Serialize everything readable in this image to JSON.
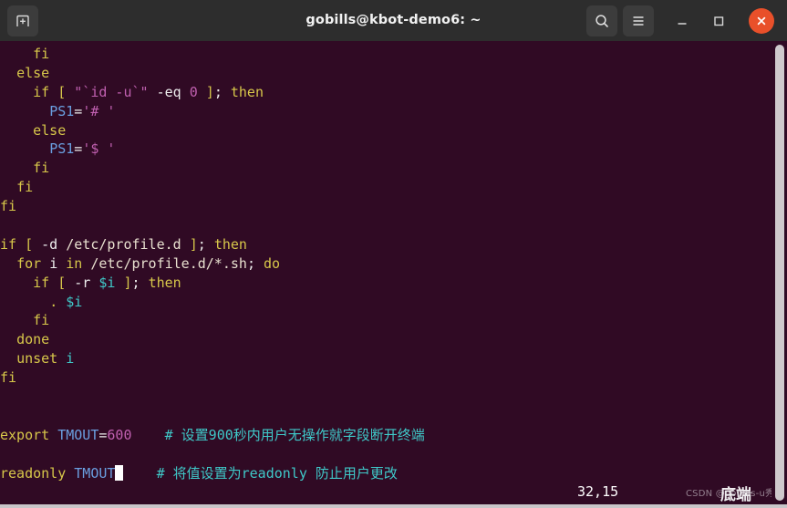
{
  "window": {
    "title": "gobills@kbot-demo6: ~",
    "titlebar_bg": "#2d2d2d",
    "terminal_bg": "#300a24",
    "close_button_color": "#e9502a"
  },
  "titlebar": {
    "new_tab_icon": "new-tab-icon",
    "search_icon": "search-icon",
    "menu_icon": "hamburger-menu-icon",
    "minimize_icon": "minimize-icon",
    "maximize_icon": "maximize-icon",
    "close_icon": "close-icon"
  },
  "terminal": {
    "lines": [
      {
        "indent": "    ",
        "segments": [
          {
            "t": "fi",
            "c": "kw"
          }
        ]
      },
      {
        "indent": "  ",
        "segments": [
          {
            "t": "else",
            "c": "kw"
          }
        ]
      },
      {
        "indent": "    ",
        "segments": [
          {
            "t": "if",
            "c": "kw"
          },
          {
            "t": " ",
            "c": "wh"
          },
          {
            "t": "[",
            "c": "kw"
          },
          {
            "t": " ",
            "c": "wh"
          },
          {
            "t": "\"`id -u`\"",
            "c": "str"
          },
          {
            "t": " ",
            "c": "wh"
          },
          {
            "t": "-eq",
            "c": "wh"
          },
          {
            "t": " ",
            "c": "wh"
          },
          {
            "t": "0",
            "c": "num"
          },
          {
            "t": " ",
            "c": "wh"
          },
          {
            "t": "]",
            "c": "kw"
          },
          {
            "t": ";",
            "c": "wh"
          },
          {
            "t": " ",
            "c": "wh"
          },
          {
            "t": "then",
            "c": "kw"
          }
        ]
      },
      {
        "indent": "      ",
        "segments": [
          {
            "t": "PS1",
            "c": "var"
          },
          {
            "t": "=",
            "c": "wh"
          },
          {
            "t": "'# '",
            "c": "str"
          }
        ]
      },
      {
        "indent": "    ",
        "segments": [
          {
            "t": "else",
            "c": "kw"
          }
        ]
      },
      {
        "indent": "      ",
        "segments": [
          {
            "t": "PS1",
            "c": "var"
          },
          {
            "t": "=",
            "c": "wh"
          },
          {
            "t": "'$ '",
            "c": "str"
          }
        ]
      },
      {
        "indent": "    ",
        "segments": [
          {
            "t": "fi",
            "c": "kw"
          }
        ]
      },
      {
        "indent": "  ",
        "segments": [
          {
            "t": "fi",
            "c": "kw"
          }
        ]
      },
      {
        "indent": "",
        "segments": [
          {
            "t": "fi",
            "c": "kw"
          }
        ]
      },
      {
        "indent": "",
        "segments": []
      },
      {
        "indent": "",
        "segments": [
          {
            "t": "if",
            "c": "kw"
          },
          {
            "t": " ",
            "c": "wh"
          },
          {
            "t": "[",
            "c": "kw"
          },
          {
            "t": " ",
            "c": "wh"
          },
          {
            "t": "-d",
            "c": "wh"
          },
          {
            "t": " ",
            "c": "wh"
          },
          {
            "t": "/etc/profile.d",
            "c": "pth"
          },
          {
            "t": " ",
            "c": "wh"
          },
          {
            "t": "]",
            "c": "kw"
          },
          {
            "t": ";",
            "c": "wh"
          },
          {
            "t": " ",
            "c": "wh"
          },
          {
            "t": "then",
            "c": "kw"
          }
        ]
      },
      {
        "indent": "  ",
        "segments": [
          {
            "t": "for",
            "c": "kw"
          },
          {
            "t": " ",
            "c": "wh"
          },
          {
            "t": "i",
            "c": "wh"
          },
          {
            "t": " ",
            "c": "wh"
          },
          {
            "t": "in",
            "c": "kw"
          },
          {
            "t": " ",
            "c": "wh"
          },
          {
            "t": "/etc/profile.d/*.sh",
            "c": "pth"
          },
          {
            "t": ";",
            "c": "wh"
          },
          {
            "t": " ",
            "c": "wh"
          },
          {
            "t": "do",
            "c": "kw"
          }
        ]
      },
      {
        "indent": "    ",
        "segments": [
          {
            "t": "if",
            "c": "kw"
          },
          {
            "t": " ",
            "c": "wh"
          },
          {
            "t": "[",
            "c": "kw"
          },
          {
            "t": " ",
            "c": "wh"
          },
          {
            "t": "-r",
            "c": "wh"
          },
          {
            "t": " ",
            "c": "wh"
          },
          {
            "t": "$i",
            "c": "cy"
          },
          {
            "t": " ",
            "c": "wh"
          },
          {
            "t": "]",
            "c": "kw"
          },
          {
            "t": ";",
            "c": "wh"
          },
          {
            "t": " ",
            "c": "wh"
          },
          {
            "t": "then",
            "c": "kw"
          }
        ]
      },
      {
        "indent": "      ",
        "segments": [
          {
            "t": ".",
            "c": "kw"
          },
          {
            "t": " ",
            "c": "wh"
          },
          {
            "t": "$i",
            "c": "cy"
          }
        ]
      },
      {
        "indent": "    ",
        "segments": [
          {
            "t": "fi",
            "c": "kw"
          }
        ]
      },
      {
        "indent": "  ",
        "segments": [
          {
            "t": "done",
            "c": "kw"
          }
        ]
      },
      {
        "indent": "  ",
        "segments": [
          {
            "t": "unset",
            "c": "kw"
          },
          {
            "t": " ",
            "c": "wh"
          },
          {
            "t": "i",
            "c": "cy"
          }
        ]
      },
      {
        "indent": "",
        "segments": [
          {
            "t": "fi",
            "c": "kw"
          }
        ]
      },
      {
        "indent": "",
        "segments": []
      },
      {
        "indent": "",
        "segments": []
      },
      {
        "indent": "",
        "segments": [
          {
            "t": "export",
            "c": "kw"
          },
          {
            "t": " ",
            "c": "wh"
          },
          {
            "t": "TMOUT",
            "c": "var"
          },
          {
            "t": "=",
            "c": "wh"
          },
          {
            "t": "600",
            "c": "num"
          },
          {
            "t": "    ",
            "c": "wh"
          },
          {
            "t": "# 设置900秒内用户无操作就字段断开终端",
            "c": "cm"
          }
        ]
      },
      {
        "indent": "",
        "segments": []
      },
      {
        "indent": "",
        "segments": [
          {
            "t": "readonly",
            "c": "kw"
          },
          {
            "t": " ",
            "c": "wh"
          },
          {
            "t": "TMOUT",
            "c": "var"
          },
          {
            "t": "",
            "c": "cursor"
          },
          {
            "t": "    ",
            "c": "wh"
          },
          {
            "t": "# 将值设置为readonly 防止用户更改",
            "c": "cm"
          }
        ]
      }
    ],
    "cursor_position": "32,15",
    "bottom_label": "底端",
    "watermark": "CSDN @gobills-u秀",
    "watermark_tail": "秀"
  }
}
